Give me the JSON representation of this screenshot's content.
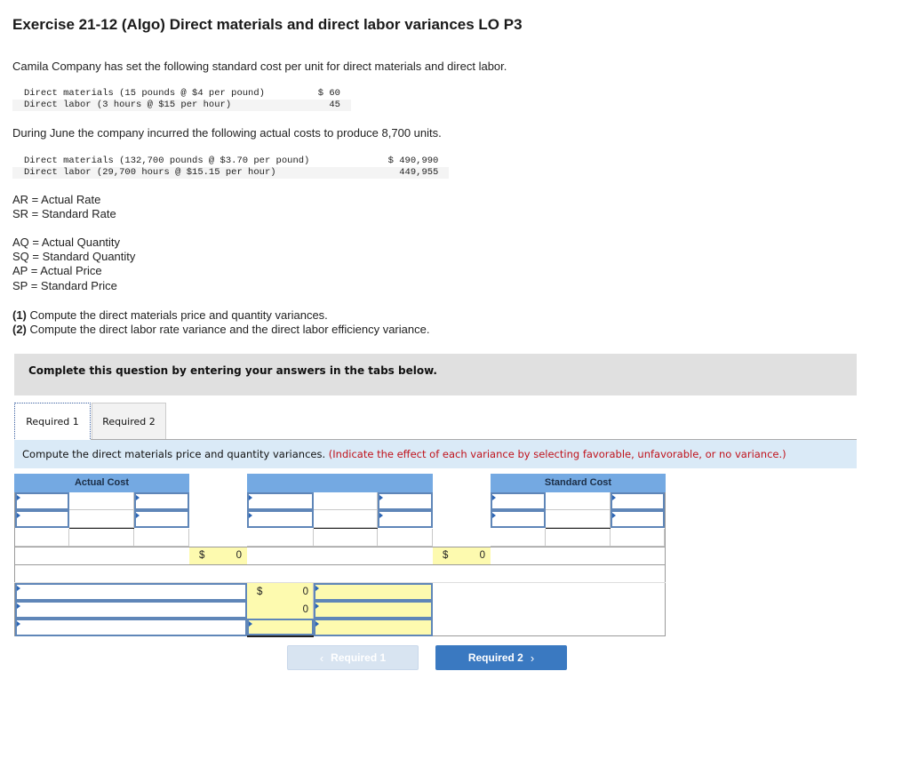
{
  "header": {
    "title": "Exercise 21-12 (Algo) Direct materials and direct labor variances LO P3"
  },
  "intro": "Camila Company has set the following standard cost per unit for direct materials and direct labor.",
  "standard_costs": [
    {
      "label": "Direct materials (15 pounds @ $4 per pound)",
      "amount": "$ 60"
    },
    {
      "label": "Direct labor (3 hours @ $15 per hour)",
      "amount": "45"
    }
  ],
  "actual_intro": "During June the company incurred the following actual costs to produce 8,700 units.",
  "actual_costs": [
    {
      "label": "Direct materials (132,700 pounds @ $3.70 per pound)",
      "amount": "$ 490,990"
    },
    {
      "label": "Direct labor (29,700 hours @ $15.15 per hour)",
      "amount": "449,955"
    }
  ],
  "definitions_rate": [
    "AR = Actual Rate",
    "SR = Standard Rate"
  ],
  "definitions_qty": [
    "AQ = Actual Quantity",
    "SQ = Standard Quantity",
    "AP = Actual Price",
    "SP = Standard Price"
  ],
  "requirements": [
    {
      "num": "(1)",
      "text": " Compute the direct materials price and quantity variances."
    },
    {
      "num": "(2)",
      "text": " Compute the direct labor rate variance and the direct labor efficiency variance."
    }
  ],
  "banner": "Complete this question by entering your answers in the tabs below.",
  "tabs": [
    {
      "label": "Required 1",
      "active": true
    },
    {
      "label": "Required 2",
      "active": false
    }
  ],
  "instruction": {
    "main": "Compute the direct materials price and quantity variances.",
    "note": "(Indicate the effect of each variance by selecting favorable, unfavorable, or no variance.)"
  },
  "worksheet": {
    "headers": {
      "actual_cost": "Actual Cost",
      "middle": "",
      "standard_cost": "Standard Cost"
    },
    "totals": [
      {
        "currency": "$",
        "value": "0"
      },
      {
        "currency": "$",
        "value": "0"
      }
    ],
    "variances": [
      {
        "currency": "$",
        "value": "0"
      },
      {
        "currency": "",
        "value": "0"
      },
      {
        "currency": "",
        "value": ""
      }
    ]
  },
  "nav": {
    "prev_label": "Required 1",
    "next_label": "Required 2",
    "prev_icon": "‹",
    "next_icon": "›"
  },
  "colors": {
    "header_blue": "#74a9e2",
    "input_yellow": "#fdfaaf",
    "note_red": "#c0121b",
    "button_blue": "#3a79c1"
  }
}
